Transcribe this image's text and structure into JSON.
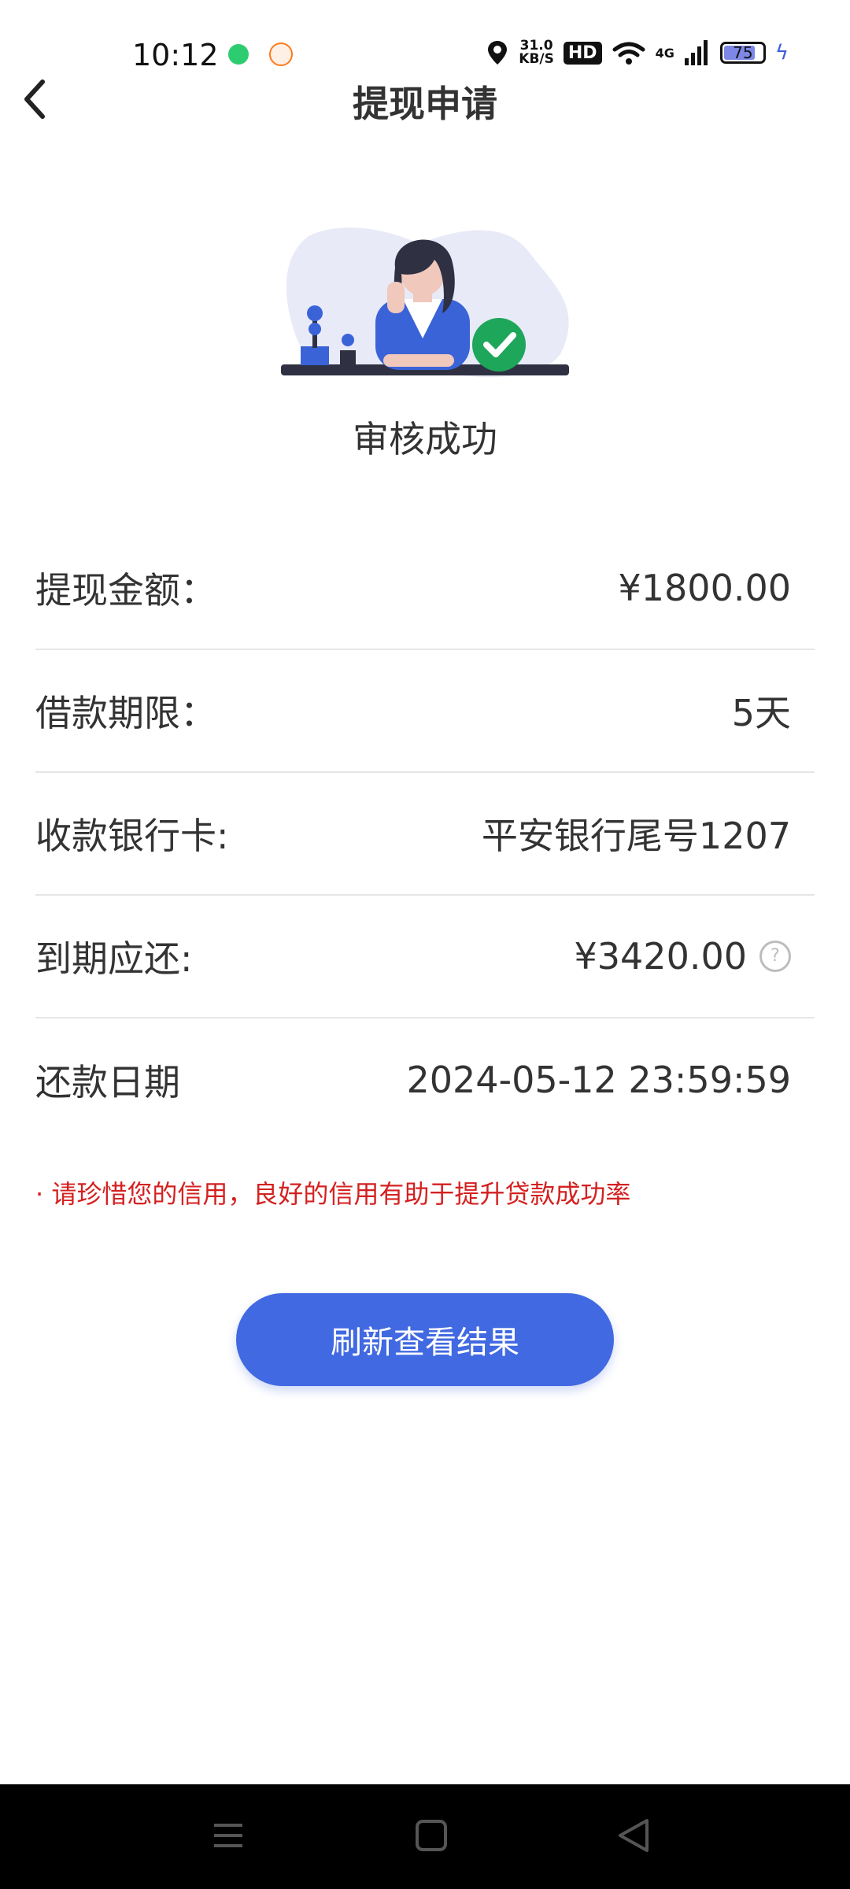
{
  "status_bar": {
    "time": "10:12",
    "net_speed_value": "31.0",
    "net_speed_unit": "KB/S",
    "hd_label": "HD",
    "network_label": "4G",
    "battery_level": "75",
    "icons": [
      "green-chat-icon",
      "orange-app-icon",
      "location-icon",
      "wifi-icon",
      "signal-icon",
      "battery-icon",
      "charging-icon"
    ]
  },
  "header": {
    "title": "提现申请",
    "back_icon": "chevron-left-icon"
  },
  "result": {
    "status_text": "审核成功",
    "badge_icon": "check-circle-icon",
    "accent_color": "#1ea65a"
  },
  "details": [
    {
      "label": "提现金额：",
      "value": "¥1800.00"
    },
    {
      "label": "借款期限：",
      "value": "5天"
    },
    {
      "label": "收款银行卡:",
      "value": "平安银行尾号1207"
    },
    {
      "label": "到期应还:",
      "value": "¥3420.00",
      "help_icon": "?"
    },
    {
      "label": "还款日期",
      "value": "2024-05-12 23:59:59"
    }
  ],
  "notice": "· 请珍惜您的信用，良好的信用有助于提升贷款成功率",
  "actions": {
    "refresh_label": "刷新查看结果",
    "button_color": "#4169e1"
  },
  "nav_bar": {
    "icons": [
      "menu-icon",
      "home-icon",
      "back-triangle-icon"
    ]
  }
}
